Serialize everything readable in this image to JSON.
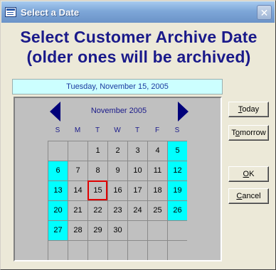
{
  "window": {
    "title": "Select a Date",
    "close_glyph": "✕"
  },
  "headline": {
    "line1": "Select Customer Archive Date",
    "line2": "(older ones will be archived)"
  },
  "selected_date_text": "Tuesday, November 15, 2005",
  "calendar": {
    "month_label": "November 2005",
    "weekdays": [
      "S",
      "M",
      "T",
      "W",
      "T",
      "F",
      "S"
    ],
    "weeks": [
      [
        "",
        "",
        "1",
        "2",
        "3",
        "4",
        "5"
      ],
      [
        "6",
        "7",
        "8",
        "9",
        "10",
        "11",
        "12"
      ],
      [
        "13",
        "14",
        "15",
        "16",
        "17",
        "18",
        "19"
      ],
      [
        "20",
        "21",
        "22",
        "23",
        "24",
        "25",
        "26"
      ],
      [
        "27",
        "28",
        "29",
        "30",
        "",
        "",
        ""
      ],
      [
        "",
        "",
        "",
        "",
        "",
        "",
        ""
      ]
    ],
    "selected_day": "15",
    "weekend_color": "#00ffff",
    "selected_border_color": "#e00000",
    "prev_icon": "triangle-left-icon",
    "next_icon": "triangle-right-icon"
  },
  "buttons": {
    "today": {
      "pre": "",
      "ul": "T",
      "post": "oday"
    },
    "tomorrow": {
      "pre": "T",
      "ul": "o",
      "post": "morrow"
    },
    "ok": {
      "pre": "",
      "ul": "O",
      "post": "K"
    },
    "cancel": {
      "pre": "",
      "ul": "C",
      "post": "ancel"
    }
  }
}
